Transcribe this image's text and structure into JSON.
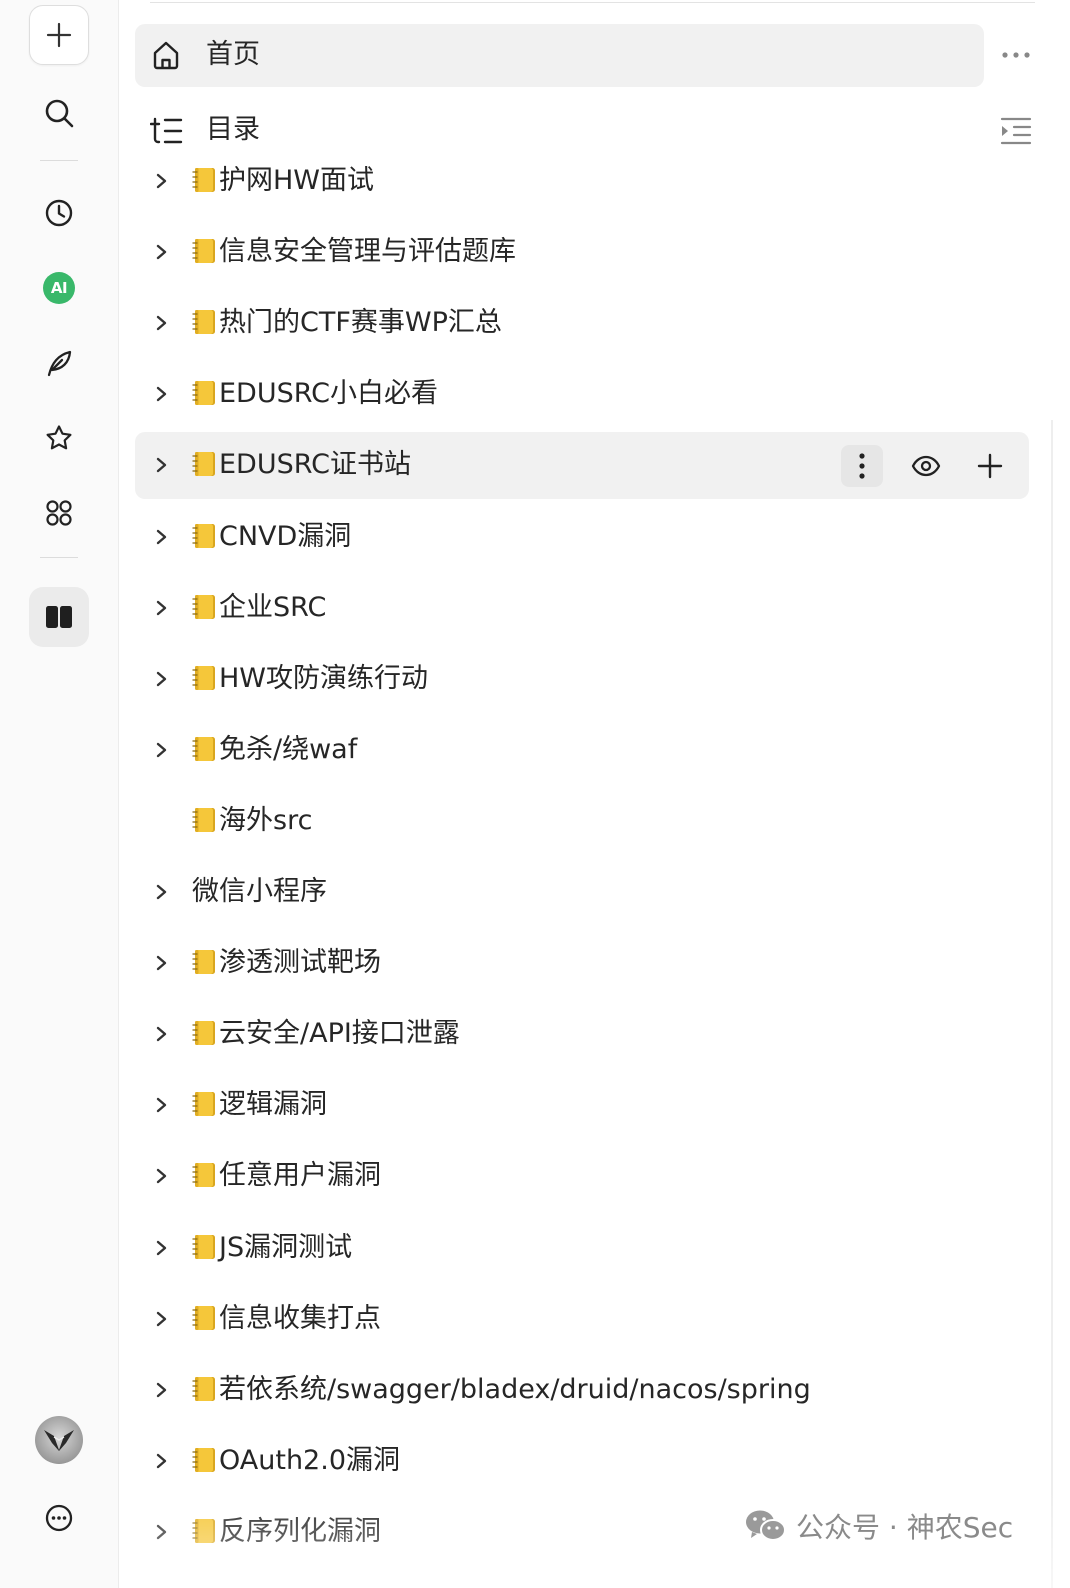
{
  "home": {
    "label": "首页"
  },
  "toc": {
    "label": "目录"
  },
  "tree": [
    {
      "title": "护网HW面试",
      "notebook": true,
      "expandable": true
    },
    {
      "title": "信息安全管理与评估题库",
      "notebook": true,
      "expandable": true
    },
    {
      "title": "热门的CTF赛事WP汇总",
      "notebook": true,
      "expandable": true
    },
    {
      "title": "EDUSRC小白必看",
      "notebook": true,
      "expandable": true
    },
    {
      "title": "EDUSRC证书站",
      "notebook": true,
      "expandable": true,
      "hovered": true
    },
    {
      "title": "CNVD漏洞",
      "notebook": true,
      "expandable": true
    },
    {
      "title": "企业SRC",
      "notebook": true,
      "expandable": true
    },
    {
      "title": "HW攻防演练行动",
      "notebook": true,
      "expandable": true
    },
    {
      "title": "免杀/绕waf",
      "notebook": true,
      "expandable": true
    },
    {
      "title": "海外src",
      "notebook": true,
      "expandable": false
    },
    {
      "title": "微信小程序",
      "notebook": false,
      "expandable": true
    },
    {
      "title": "渗透测试靶场",
      "notebook": true,
      "expandable": true
    },
    {
      "title": "云安全/API接口泄露",
      "notebook": true,
      "expandable": true
    },
    {
      "title": "逻辑漏洞",
      "notebook": true,
      "expandable": true
    },
    {
      "title": "任意用户漏洞",
      "notebook": true,
      "expandable": true
    },
    {
      "title": "JS漏洞测试",
      "notebook": true,
      "expandable": true
    },
    {
      "title": "信息收集打点",
      "notebook": true,
      "expandable": true
    },
    {
      "title": "若依系统/swagger/bladex/druid/nacos/spring",
      "notebook": true,
      "expandable": true
    },
    {
      "title": "OAuth2.0漏洞",
      "notebook": true,
      "expandable": true
    },
    {
      "title": "反序列化漏洞",
      "notebook": true,
      "expandable": true
    }
  ],
  "rail": {
    "ai_badge": "AI",
    "icons": [
      "plus-icon",
      "search-icon",
      "clock-icon",
      "ai-icon",
      "feather-icon",
      "star-icon",
      "apps-icon",
      "book-icon",
      "avatar",
      "chat-more-icon"
    ]
  },
  "watermark": {
    "text": "公众号 · 神农Sec"
  },
  "colors": {
    "accent_ai": "#39b86a",
    "hover_bg": "#f1f1f1",
    "notebook": "#f2c230"
  }
}
